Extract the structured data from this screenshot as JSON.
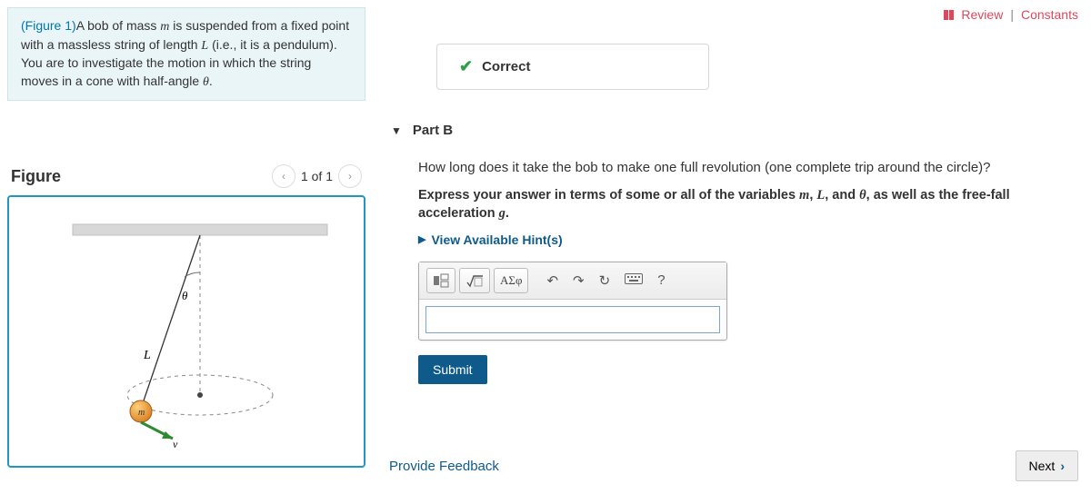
{
  "topLinks": {
    "review": "Review",
    "constants": "Constants"
  },
  "problem": {
    "figref": "(Figure 1)",
    "t1": "A bob of mass ",
    "m": "m",
    "t2": " is suspended from a fixed point with a massless string of length ",
    "L": "L",
    "t3": " (i.e., it is a pendulum). You are to investigate the motion in which the string moves in a cone with half-angle ",
    "theta": "θ",
    "t4": "."
  },
  "figure": {
    "title": "Figure",
    "pager": "1 of 1"
  },
  "correct": {
    "label": "Correct"
  },
  "partB": {
    "label": "Part B",
    "question": "How long does it take the bob to make one full revolution (one complete trip around the circle)?",
    "instr1": "Express your answer in terms of some or all of the variables ",
    "v1": "m",
    "c1": ", ",
    "v2": "L",
    "c2": ", and ",
    "v3": "θ",
    "instr2": ", as well as the free-fall acceleration ",
    "v4": "g",
    "instr3": ".",
    "hints": "View Available Hint(s)",
    "greek": "ΑΣφ",
    "help": "?",
    "submit": "Submit"
  },
  "footer": {
    "feedback": "Provide Feedback",
    "next": "Next"
  }
}
